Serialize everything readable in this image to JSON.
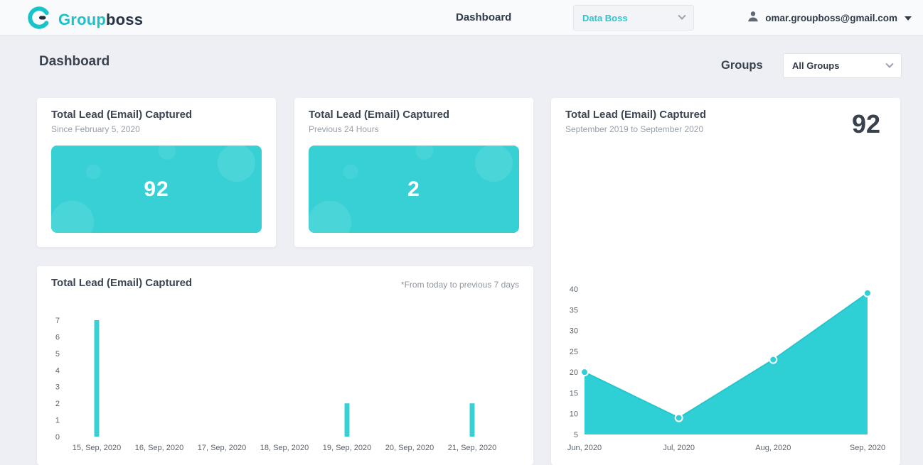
{
  "colors": {
    "accent_teal": "#36d0d5",
    "logo_teal": "#18c3ca",
    "dark_text": "#2f3a49",
    "page_background": "#edeff4"
  },
  "navbar": {
    "logo_text_1": "Group",
    "logo_text_2": "boss",
    "dashboard_link": "Dashboard",
    "team_dropdown_value": "Data Boss",
    "user_email": "omar.groupboss@gmail.com"
  },
  "page": {
    "title": "Dashboard",
    "groups_label": "Groups",
    "groups_dropdown_value": "All Groups"
  },
  "cards": {
    "since": {
      "title": "Total Lead (Email) Captured",
      "subtitle": "Since February 5, 2020",
      "value": "92"
    },
    "last24": {
      "title": "Total Lead (Email) Captured",
      "subtitle": "Previous 24 Hours",
      "value": "2"
    },
    "yearly": {
      "title": "Total Lead (Email) Captured",
      "subtitle": "September 2019 to September 2020",
      "total": "92"
    },
    "weekly": {
      "title": "Total Lead (Email) Captured",
      "note": "*From today to previous 7 days"
    }
  },
  "chart_data": [
    {
      "id": "weekly_bar",
      "type": "bar",
      "title": "Total Lead (Email) Captured",
      "annotation": "*From today to previous 7 days",
      "categories": [
        "15, Sep, 2020",
        "16, Sep, 2020",
        "17, Sep, 2020",
        "18, Sep, 2020",
        "19, Sep, 2020",
        "20, Sep, 2020",
        "21, Sep, 2020"
      ],
      "values": [
        7,
        0,
        0,
        0,
        2,
        0,
        2
      ],
      "ylim": [
        0,
        7
      ],
      "yticks": [
        0,
        1,
        2,
        3,
        4,
        5,
        6,
        7
      ],
      "color": "#38d0d5",
      "grid": false,
      "legend": false
    },
    {
      "id": "yearly_area",
      "type": "area",
      "title": "Total Lead (Email) Captured",
      "subtitle": "September 2019 to September 2020",
      "total": 92,
      "x": [
        "Jun, 2020",
        "Jul, 2020",
        "Aug, 2020",
        "Sep, 2020"
      ],
      "values": [
        20,
        9,
        23,
        39
      ],
      "ylim": [
        5,
        40
      ],
      "yticks": [
        5,
        10,
        15,
        20,
        25,
        30,
        35,
        40
      ],
      "color": "#2fd0d5",
      "line_color": "#26c5cb",
      "grid": false,
      "legend": false
    }
  ]
}
